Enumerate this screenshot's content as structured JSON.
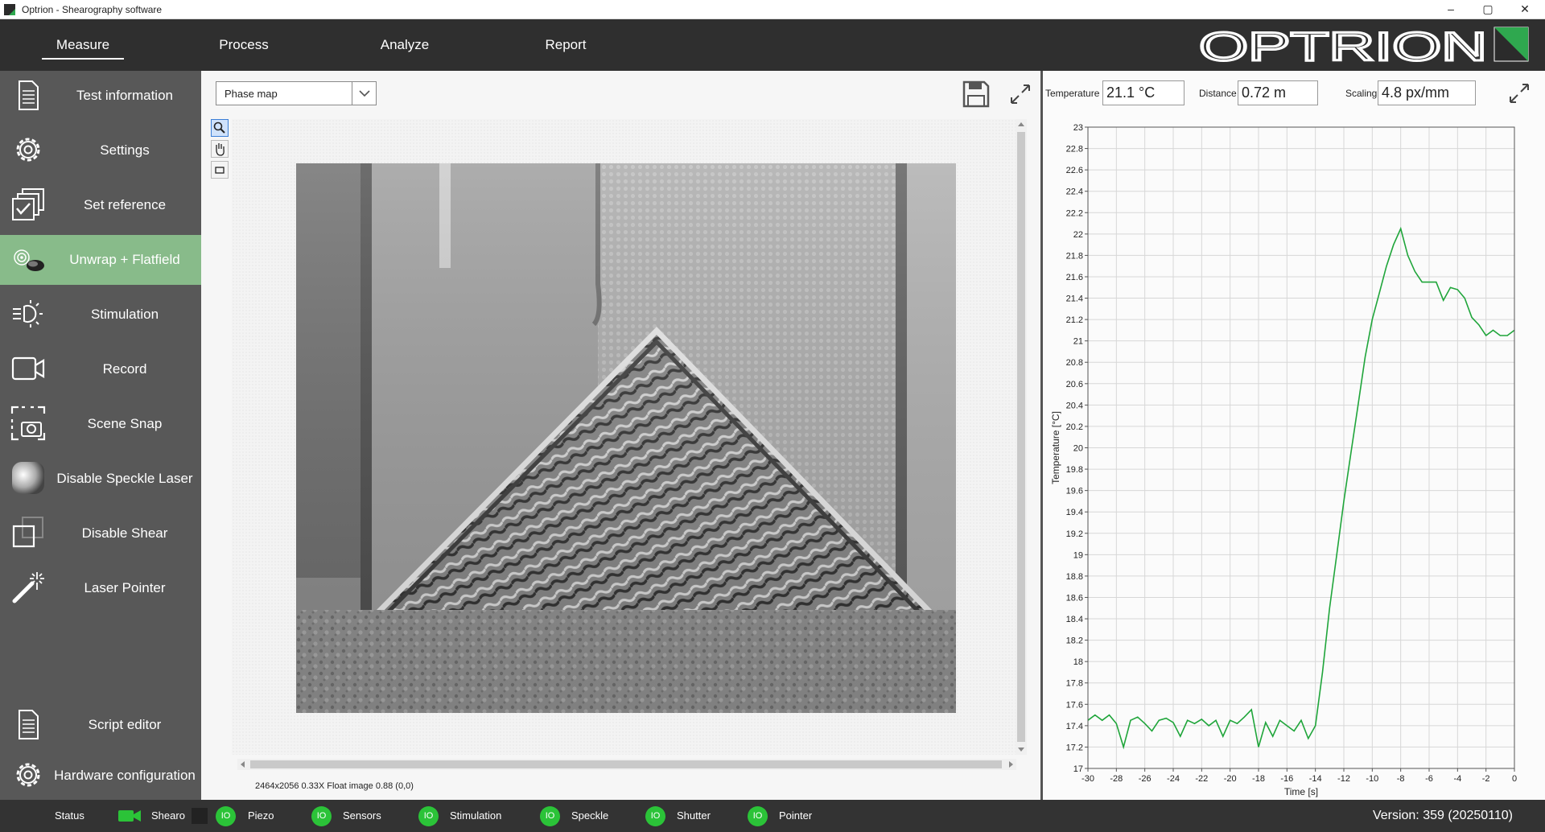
{
  "window": {
    "title": "Optrion - Shearography software",
    "controls": [
      "–",
      "▢",
      "✕"
    ]
  },
  "topnav": {
    "tabs": [
      {
        "label": "Measure",
        "active": true
      },
      {
        "label": "Process",
        "active": false
      },
      {
        "label": "Analyze",
        "active": false
      },
      {
        "label": "Report",
        "active": false
      }
    ],
    "logo_text": "OPTRION",
    "brand_color": "#2fa84f"
  },
  "sidebar": {
    "items": [
      {
        "label": "Test information",
        "icon": "document-icon"
      },
      {
        "label": "Settings",
        "icon": "gear-icon"
      },
      {
        "label": "Set reference",
        "icon": "stacked-check-icon"
      },
      {
        "label": "Unwrap + Flatfield",
        "icon": "unwrap-icon",
        "active": true
      },
      {
        "label": "Stimulation",
        "icon": "heat-lamp-icon"
      },
      {
        "label": "Record",
        "icon": "video-camera-icon"
      },
      {
        "label": "Scene Snap",
        "icon": "snapshot-camera-icon"
      },
      {
        "label": "Disable Speckle Laser",
        "icon": "speckle-icon"
      },
      {
        "label": "Disable Shear",
        "icon": "shear-icon"
      },
      {
        "label": "Laser Pointer",
        "icon": "laser-pointer-icon"
      },
      {
        "label": "Script editor",
        "icon": "script-icon"
      },
      {
        "label": "Hardware configuration",
        "icon": "gear-icon"
      }
    ]
  },
  "viewer": {
    "view_select": "Phase map",
    "tools": [
      "zoom-icon",
      "pan-hand-icon",
      "rectangle-select-icon"
    ],
    "info": "2464x2056 0.33X Float image 0.88    (0,0)"
  },
  "readouts": {
    "temperature_label": "Temperature",
    "temperature_value": "21.1 °C",
    "distance_label": "Distance",
    "distance_value": "0.72 m",
    "scaling_label": "Scaling",
    "scaling_value": "4.8 px/mm"
  },
  "chart_data": {
    "type": "line",
    "xlabel": "Time [s]",
    "ylabel": "Temperature [°C]",
    "xlim": [
      -30,
      0
    ],
    "ylim": [
      17,
      23
    ],
    "xticks": [
      -30,
      -28,
      -26,
      -24,
      -22,
      -20,
      -18,
      -16,
      -14,
      -12,
      -10,
      -8,
      -6,
      -4,
      -2,
      0
    ],
    "yticks": [
      17,
      17.2,
      17.4,
      17.6,
      17.8,
      18,
      18.2,
      18.4,
      18.6,
      18.8,
      19,
      19.2,
      19.4,
      19.6,
      19.8,
      20,
      20.2,
      20.4,
      20.6,
      20.8,
      21,
      21.2,
      21.4,
      21.6,
      21.8,
      22,
      22.2,
      22.4,
      22.6,
      22.8,
      23
    ],
    "grid": true,
    "series": [
      {
        "color": "#1fa53a",
        "x": [
          -30,
          -29.5,
          -29,
          -28.5,
          -28,
          -27.5,
          -27,
          -26.5,
          -26,
          -25.5,
          -25,
          -24.5,
          -24,
          -23.5,
          -23,
          -22.5,
          -22,
          -21.5,
          -21,
          -20.5,
          -20,
          -19.5,
          -19,
          -18.5,
          -18,
          -17.5,
          -17,
          -16.5,
          -16,
          -15.5,
          -15,
          -14.5,
          -14,
          -13.5,
          -13,
          -12.5,
          -12,
          -11.5,
          -11,
          -10.5,
          -10,
          -9.5,
          -9,
          -8.5,
          -8,
          -7.5,
          -7,
          -6.5,
          -6,
          -5.5,
          -5,
          -4.5,
          -4,
          -3.5,
          -3,
          -2.5,
          -2,
          -1.5,
          -1,
          -0.5,
          0
        ],
        "y": [
          17.45,
          17.5,
          17.45,
          17.5,
          17.42,
          17.2,
          17.45,
          17.48,
          17.42,
          17.35,
          17.45,
          17.47,
          17.43,
          17.3,
          17.45,
          17.42,
          17.46,
          17.4,
          17.45,
          17.3,
          17.45,
          17.42,
          17.48,
          17.55,
          17.2,
          17.43,
          17.3,
          17.45,
          17.4,
          17.35,
          17.45,
          17.28,
          17.4,
          17.9,
          18.5,
          19.0,
          19.5,
          19.95,
          20.4,
          20.85,
          21.2,
          21.45,
          21.7,
          21.9,
          22.05,
          21.8,
          21.65,
          21.55,
          21.55,
          21.55,
          21.38,
          21.5,
          21.48,
          21.4,
          21.22,
          21.15,
          21.05,
          21.1,
          21.05,
          21.05,
          21.1
        ]
      }
    ]
  },
  "status": {
    "status_label": "Status",
    "shearo_label": "Shearo",
    "items": [
      {
        "badge": "IO",
        "label": "Piezo"
      },
      {
        "badge": "IO",
        "label": "Sensors"
      },
      {
        "badge": "IO",
        "label": "Stimulation"
      },
      {
        "badge": "IO",
        "label": "Speckle"
      },
      {
        "badge": "IO",
        "label": "Shutter"
      },
      {
        "badge": "IO",
        "label": "Pointer"
      }
    ],
    "version": "Version: 359 (20250110)"
  }
}
